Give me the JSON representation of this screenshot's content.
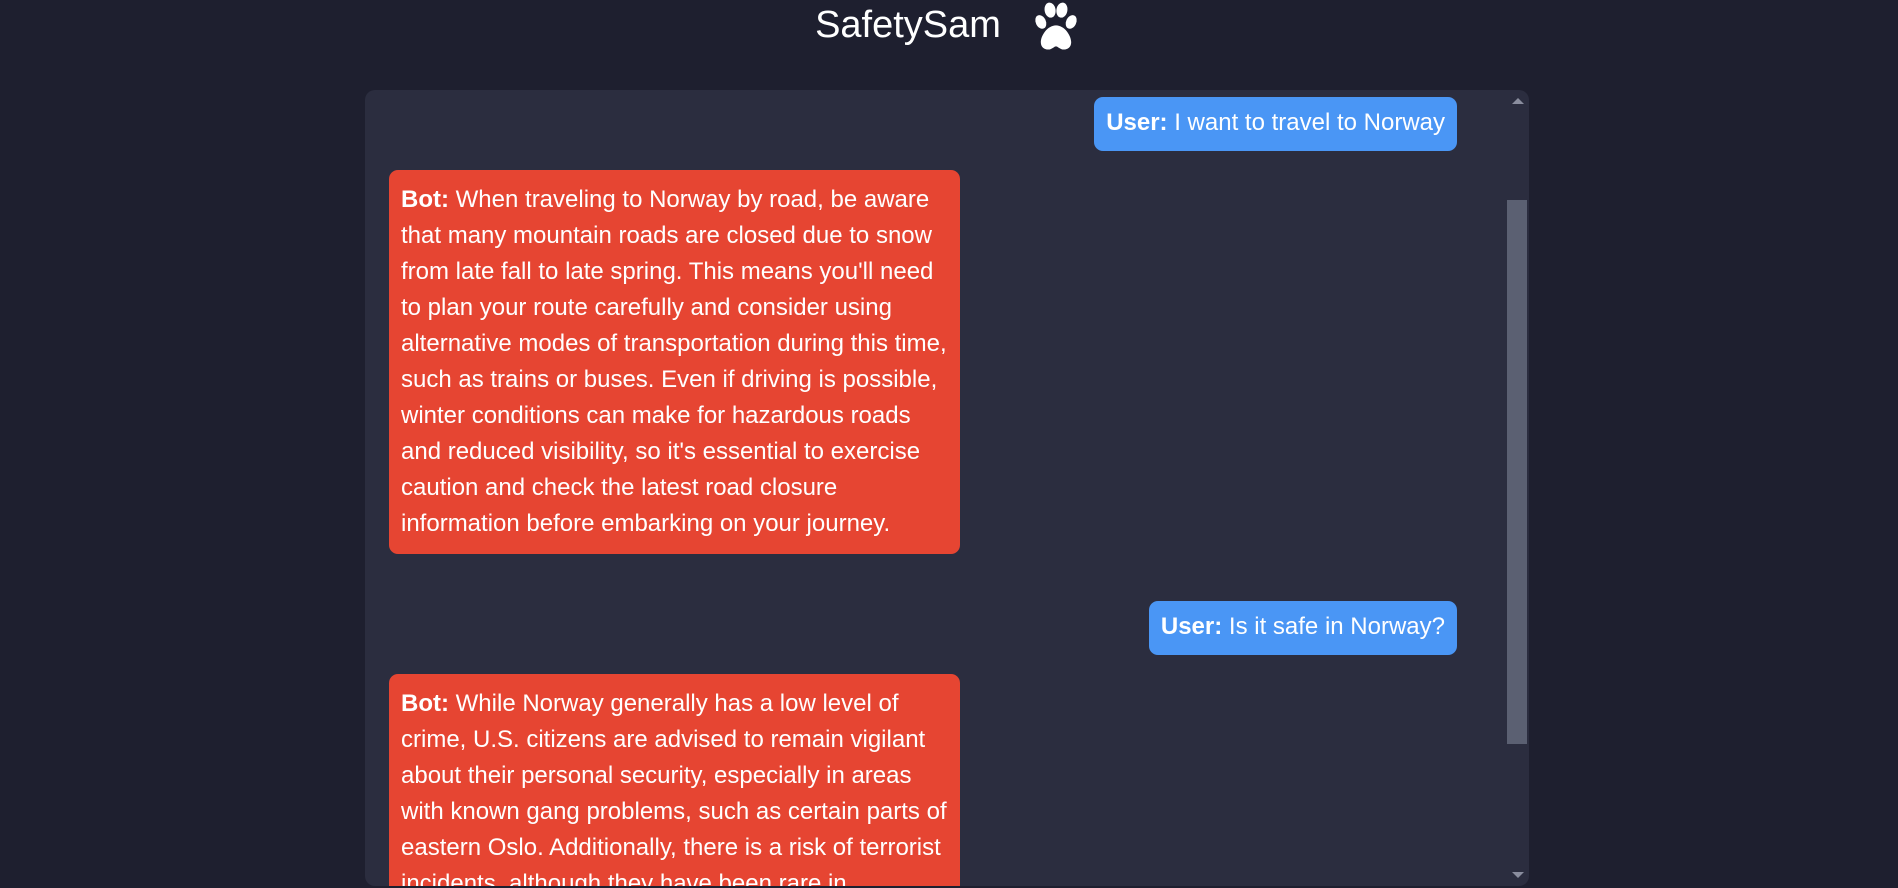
{
  "app": {
    "title": "SafetySam",
    "logo_icon": "paw-icon"
  },
  "colors": {
    "background": "#1e1f2f",
    "panel": "#2b2d3f",
    "user_bubble": "#4a96f5",
    "bot_bubble": "#e64532"
  },
  "messages": [
    {
      "role": "user",
      "sender": "User:",
      "text": "I want to travel to Norway"
    },
    {
      "role": "bot",
      "sender": "Bot:",
      "text": "When traveling to Norway by road, be aware that many mountain roads are closed due to snow from late fall to late spring. This means you'll need to plan your route carefully and consider using alternative modes of transportation during this time, such as trains or buses. Even if driving is possible, winter conditions can make for hazardous roads and reduced visibility, so it's essential to exercise caution and check the latest road closure information before embarking on your journey."
    },
    {
      "role": "user",
      "sender": "User:",
      "text": "Is it safe in Norway?"
    },
    {
      "role": "bot",
      "sender": "Bot:",
      "text": "While Norway generally has a low level of crime, U.S. citizens are advised to remain vigilant about their personal security, especially in areas with known gang problems, such as certain parts of eastern Oslo. Additionally, there is a risk of terrorist incidents, although they have been rare in"
    }
  ]
}
